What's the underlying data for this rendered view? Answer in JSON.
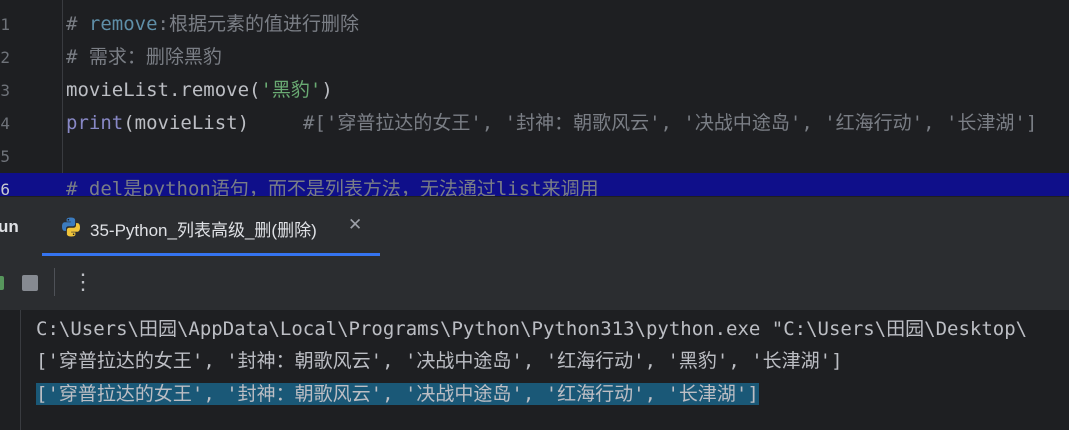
{
  "editor": {
    "lines": [
      {
        "num": "1",
        "comment_prefix": "# ",
        "comment_keyword": "remove",
        "comment_rest": ":根据元素的值进行删除"
      },
      {
        "num": "2",
        "comment": "# 需求：删除黑豹"
      },
      {
        "num": "3",
        "code_before": "movieList.remove(",
        "string": "'黑豹'",
        "code_after": ")"
      },
      {
        "num": "4",
        "builtin": "print",
        "code": "(movieList)",
        "trailing_comment": "#['穿普拉达的女王', '封神：朝歌风云', '决战中途岛', '红海行动', '长津湖']"
      },
      {
        "num": "5"
      },
      {
        "num": "6",
        "comment": "# del是python语句，而不是列表方法，无法通过list来调用"
      }
    ]
  },
  "run_panel": {
    "label": "un",
    "tab_title": "35-Python_列表高级_删(删除)",
    "close_glyph": "✕",
    "more_glyph": "⋮"
  },
  "console": {
    "lines": [
      "C:\\Users\\田园\\AppData\\Local\\Programs\\Python\\Python313\\python.exe \"C:\\Users\\田园\\Desktop\\",
      "['穿普拉达的女王', '封神：朝歌风云', '决战中途岛', '红海行动', '黑豹', '长津湖']",
      "['穿普拉达的女王', '封神：朝歌风云', '决战中途岛', '红海行动', '长津湖']"
    ]
  },
  "colors": {
    "editor_bg": "#1e1f22",
    "panel_bg": "#2b2d30",
    "current_line": "#0f0f8a",
    "selection": "#1a5877",
    "tab_underline": "#3574f0",
    "string": "#6aab73",
    "comment": "#7a7e85"
  },
  "icons": {
    "tab": "python-icon",
    "stop": "stop-icon",
    "more": "more-vertical-icon",
    "close": "close-icon"
  }
}
